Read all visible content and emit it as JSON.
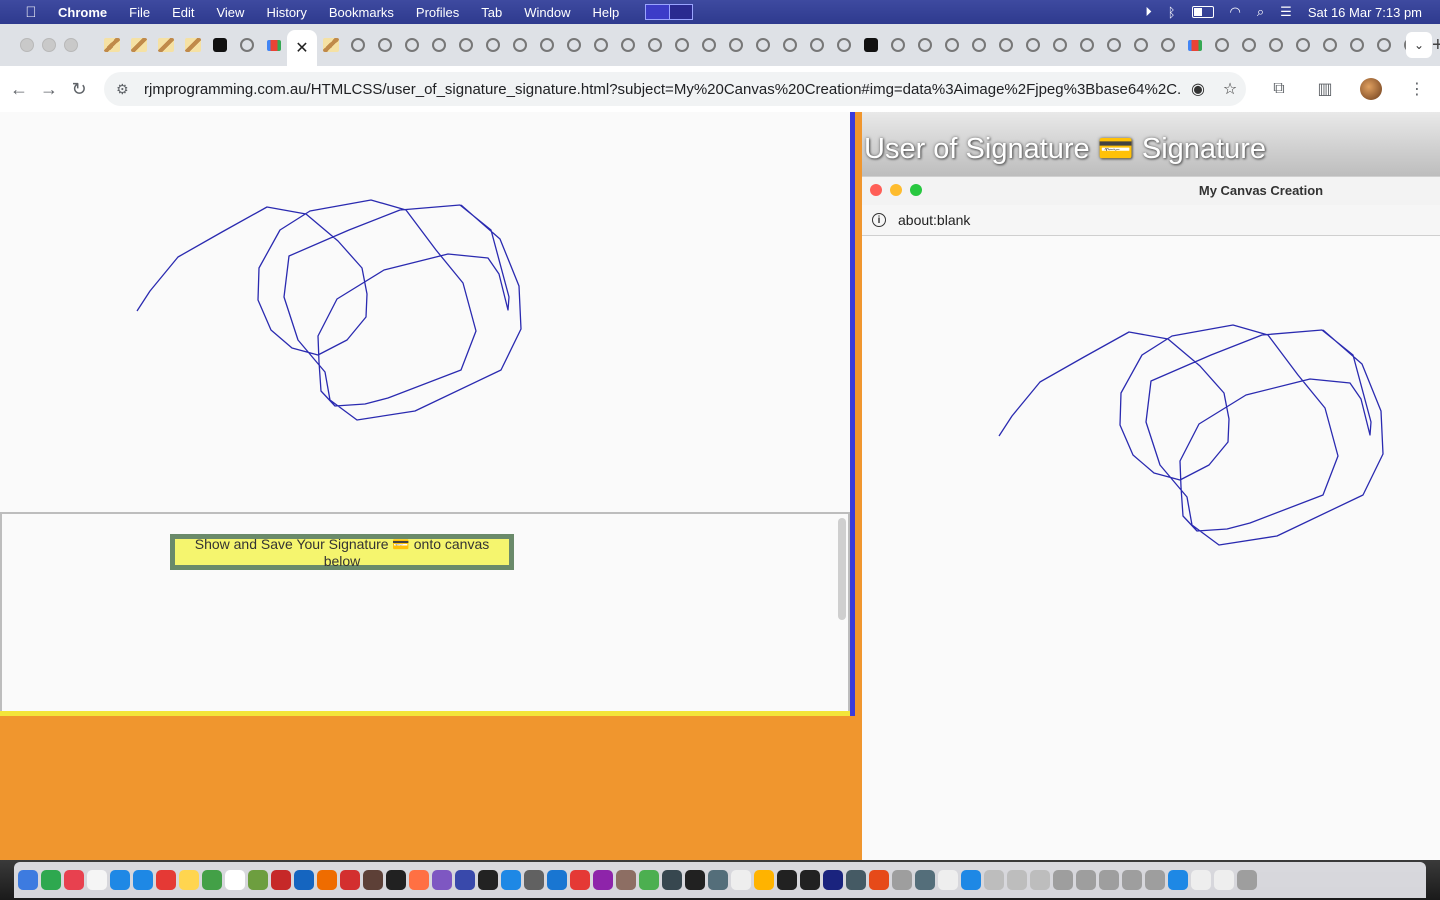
{
  "menubar": {
    "apple_icon": "apple-icon",
    "items": [
      "Chrome",
      "File",
      "Edit",
      "View",
      "History",
      "Bookmarks",
      "Profiles",
      "Tab",
      "Window",
      "Help"
    ],
    "datetime": "Sat 16 Mar  7:13 pm"
  },
  "browser": {
    "active_tab_close": "✕",
    "new_tab": "+",
    "tab_search": "⌄",
    "url": "rjmprogramming.com.au/HTMLCSS/user_of_signature_signature.html?subject=My%20Canvas%20Creation#img=data%3Aimage%2Fjpeg%3Bbase64%2C..."
  },
  "page": {
    "button_label": "Show and Save Your Signature 💳 onto canvas below",
    "heading": "User of Signature 💳 Signature"
  },
  "popup": {
    "title": "My Canvas Creation",
    "url": "about:blank"
  },
  "colors": {
    "signature_stroke": "#2a2ab0",
    "orange": "#f0962e",
    "button_bg": "#f5f56e"
  }
}
